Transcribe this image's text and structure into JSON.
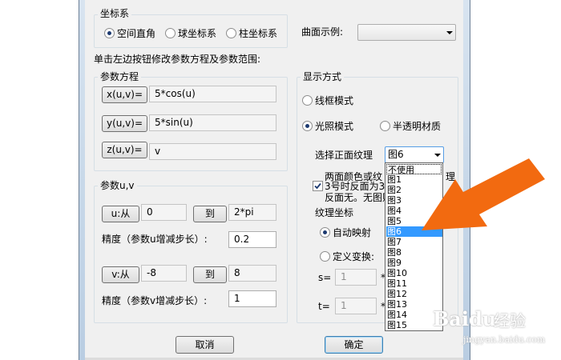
{
  "coord": {
    "label": "坐标系",
    "options": [
      "空间直角",
      "球坐标系",
      "柱坐标系"
    ],
    "selected": 0
  },
  "surface_example": {
    "label": "曲面示例:",
    "value": ""
  },
  "hint": "单击左边按钮修改参数方程及参数范围:",
  "equations": {
    "label": "参数方程",
    "x_btn": "x(u,v)=",
    "x_val": "5*cos(u)",
    "y_btn": "y(u,v)=",
    "y_val": "5*sin(u)",
    "z_btn": "z(u,v)=",
    "z_val": "v"
  },
  "params": {
    "label": "参数u,v",
    "u_from_btn": "u:从",
    "u_from": "0",
    "u_to_btn": "到",
    "u_to": "2*pi",
    "u_step_label": "精度（参数u增减步长）:",
    "u_step": "0.2",
    "v_from_btn": "v:从",
    "v_from": "-8",
    "v_to_btn": "到",
    "v_to": "8",
    "v_step_label": "精度（参数v增减步长）:",
    "v_step": "1"
  },
  "display": {
    "label": "显示方式",
    "wireframe": "线框模式",
    "lighting": "光照模式",
    "translucent": "半透明材质",
    "front_texture_label": "选择正面纹理",
    "front_texture_value": "图6",
    "twoside_text_1": "两面颜色或纹",
    "twoside_text_1b": "理",
    "twoside_text_2": "3号时反面为3",
    "twoside_text_3": "反面无。无图贴",
    "texcoord_label": "纹理坐标",
    "auto_map": "自动映射",
    "custom_transform": "定义变换:",
    "s_label": "s=",
    "s_val": "1",
    "t_label": "t=",
    "t_val": "1"
  },
  "dropdown_items": [
    "不使用",
    "图1",
    "图2",
    "图3",
    "图4",
    "图5",
    "图6",
    "图7",
    "图8",
    "图9",
    "图10",
    "图11",
    "图12",
    "图13",
    "图14",
    "图15"
  ],
  "dropdown_selected_index": 6,
  "buttons": {
    "cancel": "取消",
    "ok": "确定"
  },
  "watermark": {
    "brand": "Baidu",
    "sub": "经验",
    "url": "jingyan.baidu.com"
  },
  "colors": {
    "arrow": "#f26a10",
    "selection": "#3399ff",
    "dialog_bg": "#f0f0f0"
  }
}
